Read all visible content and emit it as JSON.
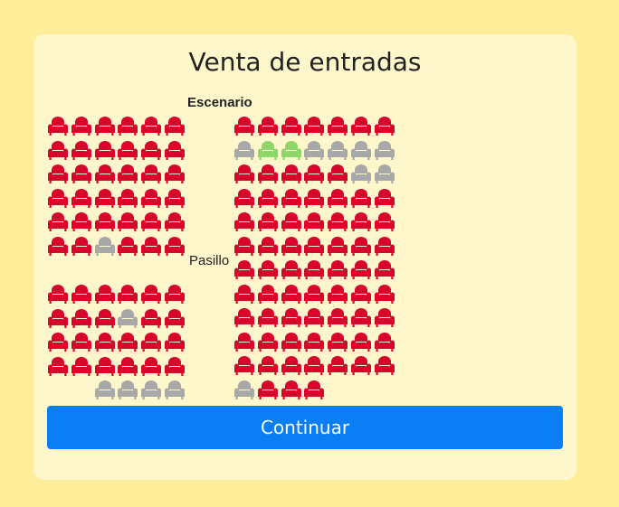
{
  "app": {
    "title": "Venta de entradas"
  },
  "labels": {
    "stage": "Escenario",
    "aisle": "Pasillo"
  },
  "colors": {
    "page_bg": "#ffee99",
    "card_bg": "#fff7cc",
    "available": "#d9042c",
    "occupied": "#a8a8a8",
    "selected": "#8fd66a",
    "button": "#0a7ff5"
  },
  "icons": {
    "seat": "armchair-icon"
  },
  "seat_sections": {
    "left_top": [
      "AAAAAA",
      "AAAAAA",
      "AAAAAA",
      "AAAAAA",
      "AAAAAA",
      "AAOAAA"
    ],
    "left_bottom": [
      "AAAAAA",
      "AAAOAA",
      "AAAAAA",
      "AAAAAA",
      "__OOOO"
    ],
    "right": [
      "AAAAAAA",
      "OSSOOOO",
      "AAAAAOO",
      "AAAAAAA",
      "AAAAAAA",
      "AAAAAAA",
      "AAAAAAA",
      "AAAAAAA",
      "AAAAAAA",
      "AAAAAAA",
      "AAAAAAA",
      "OAAA___"
    ]
  },
  "actions": {
    "continue_label": "Continuar"
  }
}
